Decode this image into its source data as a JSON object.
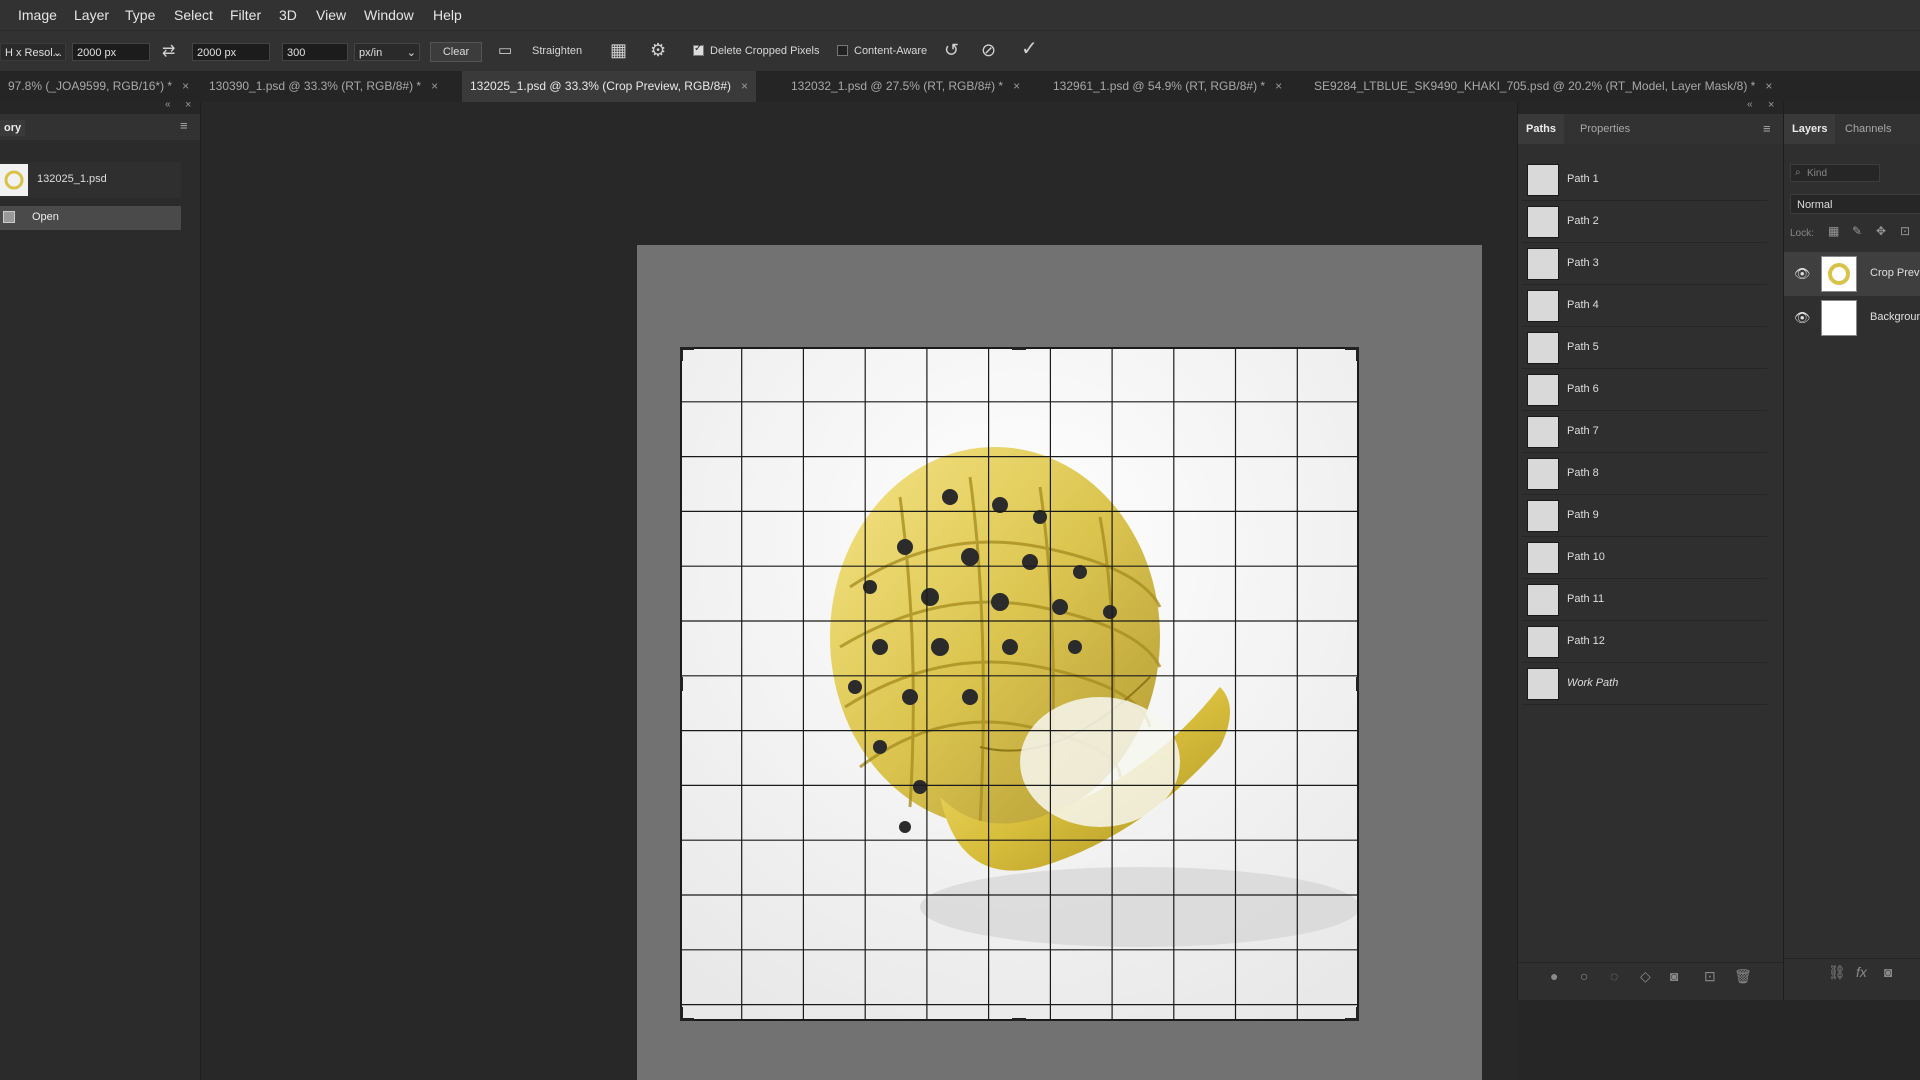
{
  "menu": [
    "Image",
    "Layer",
    "Type",
    "Select",
    "Filter",
    "3D",
    "View",
    "Window",
    "Help"
  ],
  "options": {
    "ratio_preset": "H x Resol...",
    "width": "2000 px",
    "height": "2000 px",
    "resolution": "300",
    "resolution_unit": "px/in",
    "clear_label": "Clear",
    "straighten_label": "Straighten",
    "delete_cropped_label": "Delete Cropped Pixels",
    "delete_cropped_checked": true,
    "content_aware_label": "Content-Aware",
    "content_aware_checked": false
  },
  "tabs": [
    {
      "label": "97.8% (_JOA9599, RGB/16*) *",
      "active": false
    },
    {
      "label": "130390_1.psd @ 33.3% (RT, RGB/8#) *",
      "active": false
    },
    {
      "label": "132025_1.psd @ 33.3% (Crop Preview, RGB/8#)",
      "active": true
    },
    {
      "label": "132032_1.psd @ 27.5% (RT, RGB/8#) *",
      "active": false
    },
    {
      "label": "132961_1.psd @ 54.9% (RT, RGB/8#) *",
      "active": false
    },
    {
      "label": "SE9284_LTBLUE_SK9490_KHAKI_705.psd @ 20.2% (RT_Model, Layer Mask/8) *",
      "active": false
    }
  ],
  "history": {
    "title": "ory",
    "snapshot": "132025_1.psd",
    "states": [
      "Open"
    ]
  },
  "paths_panel": {
    "tabs": [
      "Paths",
      "Properties"
    ],
    "paths": [
      "Path 1",
      "Path 2",
      "Path 3",
      "Path 4",
      "Path 5",
      "Path 6",
      "Path 7",
      "Path 8",
      "Path 9",
      "Path 10",
      "Path 11",
      "Path 12"
    ],
    "work_path": "Work Path"
  },
  "layers_panel": {
    "tabs": [
      "Layers",
      "Channels"
    ],
    "kind_placeholder": "Kind",
    "blend_mode": "Normal",
    "lock_label": "Lock:",
    "layers": [
      {
        "name": "Crop Preview",
        "visible": true
      },
      {
        "name": "Background",
        "visible": true
      }
    ]
  },
  "colors": {
    "ring_gold": "#d8c24a",
    "ui_dark": "#262626",
    "panel": "#2f2f2f"
  }
}
